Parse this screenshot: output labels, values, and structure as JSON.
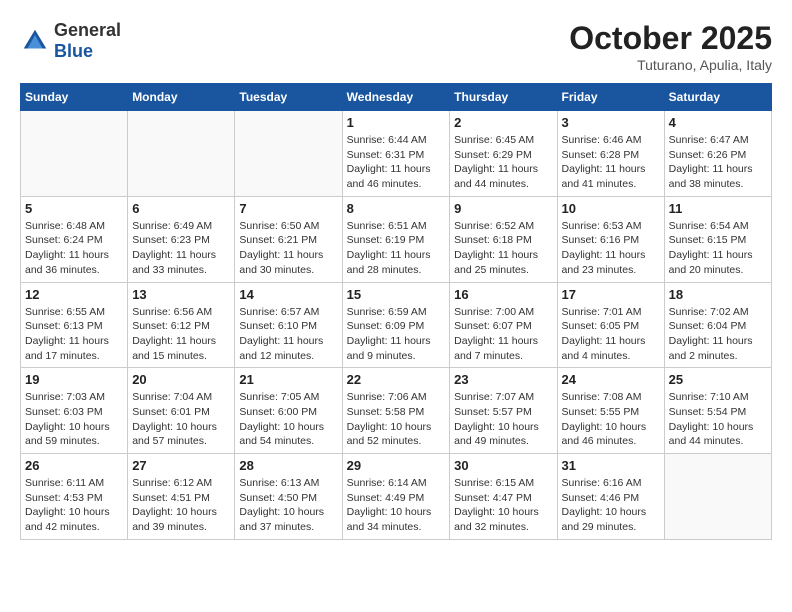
{
  "logo": {
    "general": "General",
    "blue": "Blue"
  },
  "title": "October 2025",
  "subtitle": "Tuturano, Apulia, Italy",
  "days_of_week": [
    "Sunday",
    "Monday",
    "Tuesday",
    "Wednesday",
    "Thursday",
    "Friday",
    "Saturday"
  ],
  "weeks": [
    [
      {
        "day": "",
        "info": ""
      },
      {
        "day": "",
        "info": ""
      },
      {
        "day": "",
        "info": ""
      },
      {
        "day": "1",
        "info": "Sunrise: 6:44 AM\nSunset: 6:31 PM\nDaylight: 11 hours\nand 46 minutes."
      },
      {
        "day": "2",
        "info": "Sunrise: 6:45 AM\nSunset: 6:29 PM\nDaylight: 11 hours\nand 44 minutes."
      },
      {
        "day": "3",
        "info": "Sunrise: 6:46 AM\nSunset: 6:28 PM\nDaylight: 11 hours\nand 41 minutes."
      },
      {
        "day": "4",
        "info": "Sunrise: 6:47 AM\nSunset: 6:26 PM\nDaylight: 11 hours\nand 38 minutes."
      }
    ],
    [
      {
        "day": "5",
        "info": "Sunrise: 6:48 AM\nSunset: 6:24 PM\nDaylight: 11 hours\nand 36 minutes."
      },
      {
        "day": "6",
        "info": "Sunrise: 6:49 AM\nSunset: 6:23 PM\nDaylight: 11 hours\nand 33 minutes."
      },
      {
        "day": "7",
        "info": "Sunrise: 6:50 AM\nSunset: 6:21 PM\nDaylight: 11 hours\nand 30 minutes."
      },
      {
        "day": "8",
        "info": "Sunrise: 6:51 AM\nSunset: 6:19 PM\nDaylight: 11 hours\nand 28 minutes."
      },
      {
        "day": "9",
        "info": "Sunrise: 6:52 AM\nSunset: 6:18 PM\nDaylight: 11 hours\nand 25 minutes."
      },
      {
        "day": "10",
        "info": "Sunrise: 6:53 AM\nSunset: 6:16 PM\nDaylight: 11 hours\nand 23 minutes."
      },
      {
        "day": "11",
        "info": "Sunrise: 6:54 AM\nSunset: 6:15 PM\nDaylight: 11 hours\nand 20 minutes."
      }
    ],
    [
      {
        "day": "12",
        "info": "Sunrise: 6:55 AM\nSunset: 6:13 PM\nDaylight: 11 hours\nand 17 minutes."
      },
      {
        "day": "13",
        "info": "Sunrise: 6:56 AM\nSunset: 6:12 PM\nDaylight: 11 hours\nand 15 minutes."
      },
      {
        "day": "14",
        "info": "Sunrise: 6:57 AM\nSunset: 6:10 PM\nDaylight: 11 hours\nand 12 minutes."
      },
      {
        "day": "15",
        "info": "Sunrise: 6:59 AM\nSunset: 6:09 PM\nDaylight: 11 hours\nand 9 minutes."
      },
      {
        "day": "16",
        "info": "Sunrise: 7:00 AM\nSunset: 6:07 PM\nDaylight: 11 hours\nand 7 minutes."
      },
      {
        "day": "17",
        "info": "Sunrise: 7:01 AM\nSunset: 6:05 PM\nDaylight: 11 hours\nand 4 minutes."
      },
      {
        "day": "18",
        "info": "Sunrise: 7:02 AM\nSunset: 6:04 PM\nDaylight: 11 hours\nand 2 minutes."
      }
    ],
    [
      {
        "day": "19",
        "info": "Sunrise: 7:03 AM\nSunset: 6:03 PM\nDaylight: 10 hours\nand 59 minutes."
      },
      {
        "day": "20",
        "info": "Sunrise: 7:04 AM\nSunset: 6:01 PM\nDaylight: 10 hours\nand 57 minutes."
      },
      {
        "day": "21",
        "info": "Sunrise: 7:05 AM\nSunset: 6:00 PM\nDaylight: 10 hours\nand 54 minutes."
      },
      {
        "day": "22",
        "info": "Sunrise: 7:06 AM\nSunset: 5:58 PM\nDaylight: 10 hours\nand 52 minutes."
      },
      {
        "day": "23",
        "info": "Sunrise: 7:07 AM\nSunset: 5:57 PM\nDaylight: 10 hours\nand 49 minutes."
      },
      {
        "day": "24",
        "info": "Sunrise: 7:08 AM\nSunset: 5:55 PM\nDaylight: 10 hours\nand 46 minutes."
      },
      {
        "day": "25",
        "info": "Sunrise: 7:10 AM\nSunset: 5:54 PM\nDaylight: 10 hours\nand 44 minutes."
      }
    ],
    [
      {
        "day": "26",
        "info": "Sunrise: 6:11 AM\nSunset: 4:53 PM\nDaylight: 10 hours\nand 42 minutes."
      },
      {
        "day": "27",
        "info": "Sunrise: 6:12 AM\nSunset: 4:51 PM\nDaylight: 10 hours\nand 39 minutes."
      },
      {
        "day": "28",
        "info": "Sunrise: 6:13 AM\nSunset: 4:50 PM\nDaylight: 10 hours\nand 37 minutes."
      },
      {
        "day": "29",
        "info": "Sunrise: 6:14 AM\nSunset: 4:49 PM\nDaylight: 10 hours\nand 34 minutes."
      },
      {
        "day": "30",
        "info": "Sunrise: 6:15 AM\nSunset: 4:47 PM\nDaylight: 10 hours\nand 32 minutes."
      },
      {
        "day": "31",
        "info": "Sunrise: 6:16 AM\nSunset: 4:46 PM\nDaylight: 10 hours\nand 29 minutes."
      },
      {
        "day": "",
        "info": ""
      }
    ]
  ]
}
